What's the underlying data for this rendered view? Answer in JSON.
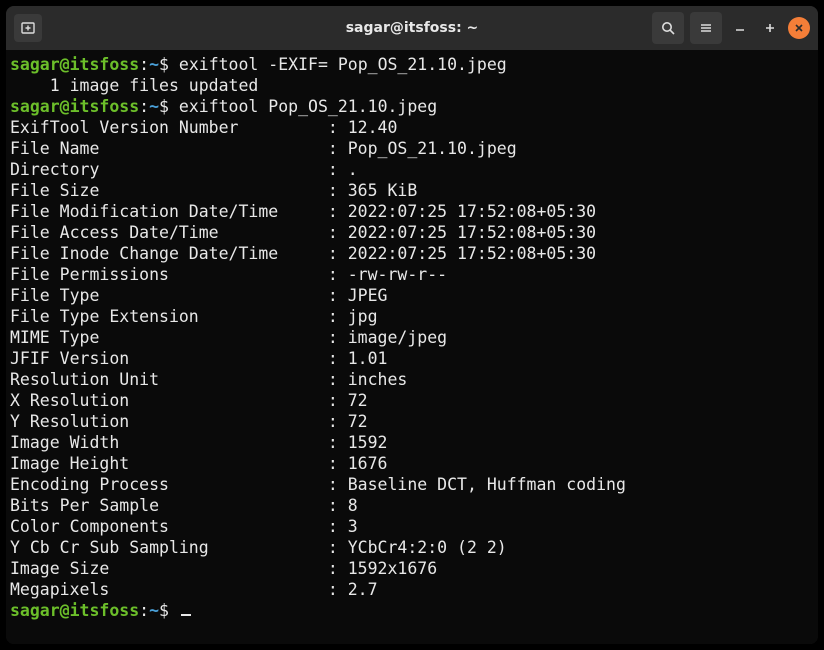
{
  "titlebar": {
    "title": "sagar@itsfoss: ~"
  },
  "prompt": {
    "user": "sagar@itsfoss",
    "colon": ":",
    "path": "~",
    "dollar": "$ "
  },
  "cmd1": "exiftool -EXIF= Pop_OS_21.10.jpeg",
  "cmd1_out": "    1 image files updated",
  "cmd2": "exiftool Pop_OS_21.10.jpeg",
  "fields": [
    {
      "k": "ExifTool Version Number",
      "v": "12.40"
    },
    {
      "k": "File Name",
      "v": "Pop_OS_21.10.jpeg"
    },
    {
      "k": "Directory",
      "v": "."
    },
    {
      "k": "File Size",
      "v": "365 KiB"
    },
    {
      "k": "File Modification Date/Time",
      "v": "2022:07:25 17:52:08+05:30"
    },
    {
      "k": "File Access Date/Time",
      "v": "2022:07:25 17:52:08+05:30"
    },
    {
      "k": "File Inode Change Date/Time",
      "v": "2022:07:25 17:52:08+05:30"
    },
    {
      "k": "File Permissions",
      "v": "-rw-rw-r--"
    },
    {
      "k": "File Type",
      "v": "JPEG"
    },
    {
      "k": "File Type Extension",
      "v": "jpg"
    },
    {
      "k": "MIME Type",
      "v": "image/jpeg"
    },
    {
      "k": "JFIF Version",
      "v": "1.01"
    },
    {
      "k": "Resolution Unit",
      "v": "inches"
    },
    {
      "k": "X Resolution",
      "v": "72"
    },
    {
      "k": "Y Resolution",
      "v": "72"
    },
    {
      "k": "Image Width",
      "v": "1592"
    },
    {
      "k": "Image Height",
      "v": "1676"
    },
    {
      "k": "Encoding Process",
      "v": "Baseline DCT, Huffman coding"
    },
    {
      "k": "Bits Per Sample",
      "v": "8"
    },
    {
      "k": "Color Components",
      "v": "3"
    },
    {
      "k": "Y Cb Cr Sub Sampling",
      "v": "YCbCr4:2:0 (2 2)"
    },
    {
      "k": "Image Size",
      "v": "1592x1676"
    },
    {
      "k": "Megapixels",
      "v": "2.7"
    }
  ]
}
